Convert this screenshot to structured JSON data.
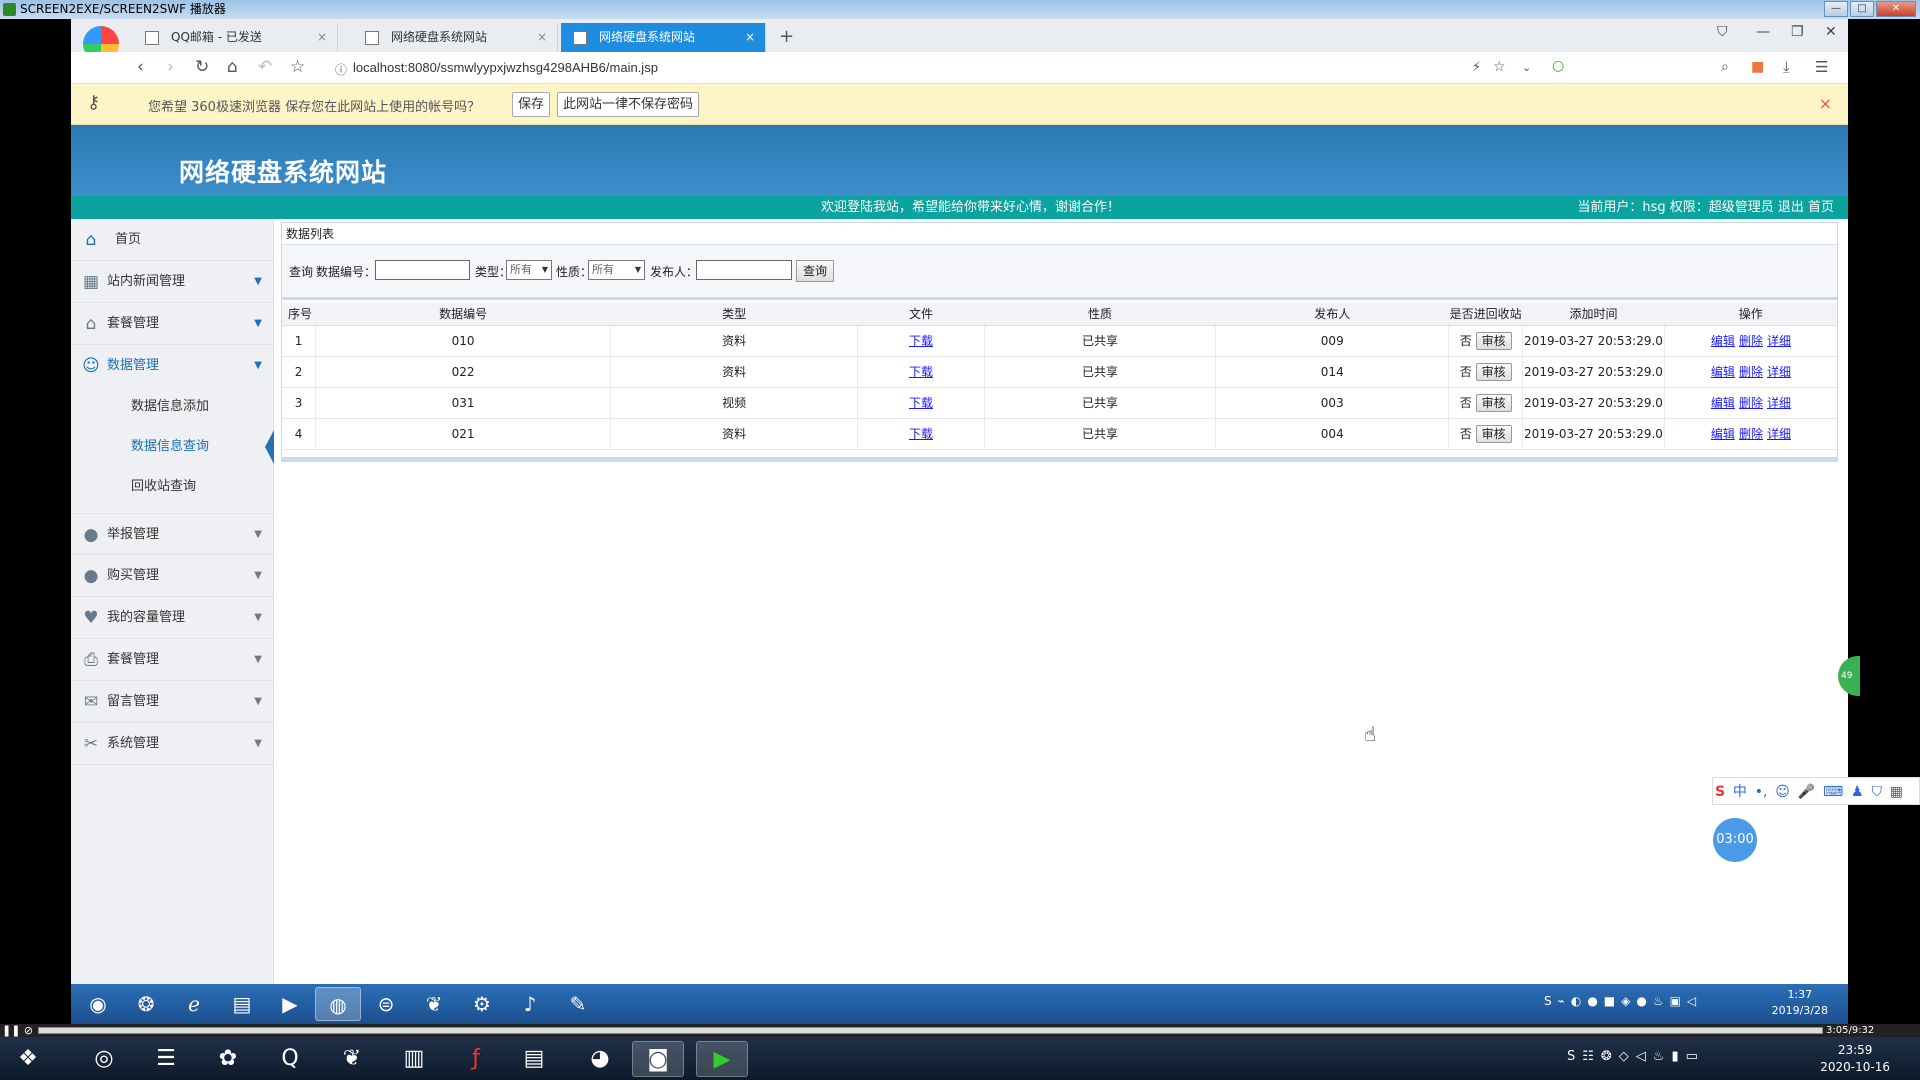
{
  "player": {
    "title": "SCREEN2EXE/SCREEN2SWF 播放器",
    "time": "3:05/9:32",
    "controls": "❚❚ ⊘"
  },
  "browser": {
    "tabs": [
      {
        "label": "QQ邮箱 - 已发送",
        "close": "×"
      },
      {
        "label": "网络硬盘系统网站",
        "close": "×"
      },
      {
        "label": "网络硬盘系统网站",
        "close": "×"
      }
    ],
    "new_tab": "+",
    "url": "localhost:8080/ssmwlyypxjwzhsg4298AHB6/main.jsp",
    "password_bar": {
      "message": "您希望 360极速浏览器 保存您在此网站上使用的帐号吗？",
      "save": "保存",
      "never": "此网站一律不保存密码",
      "close": "×"
    }
  },
  "site": {
    "title": "网络硬盘系统网站",
    "welcome": "欢迎登陆我站，希望能给你带来好心情，谢谢合作！",
    "user_info": "当前用户：hsg 权限：超级管理员 退出 首页"
  },
  "sidebar": {
    "home": "首页",
    "items": [
      {
        "label": "站内新闻管理",
        "icon": "grid-icon"
      },
      {
        "label": "套餐管理",
        "icon": "home-icon"
      },
      {
        "label": "数据管理",
        "icon": "users-icon"
      }
    ],
    "subitems": [
      "数据信息添加",
      "数据信息查询",
      "回收站查询"
    ],
    "items2": [
      {
        "label": "举报管理",
        "icon": "user-icon"
      },
      {
        "label": "购买管理",
        "icon": "user-icon"
      },
      {
        "label": "我的容量管理",
        "icon": "heart-icon"
      },
      {
        "label": "套餐管理",
        "icon": "printer-icon"
      },
      {
        "label": "留言管理",
        "icon": "message-icon"
      },
      {
        "label": "系统管理",
        "icon": "tools-icon"
      }
    ]
  },
  "panel": {
    "title": "数据列表",
    "query": {
      "prefix": "查询",
      "code_label": "数据编号：",
      "type_label": "类型：",
      "type_value": "所有",
      "nature_label": "性质：",
      "nature_value": "所有",
      "publisher_label": "发布人：",
      "button": "查询"
    },
    "columns": [
      "序号",
      "数据编号",
      "类型",
      "文件",
      "性质",
      "发布人",
      "是否进回收站",
      "添加时间",
      "操作"
    ],
    "rows": [
      {
        "no": "1",
        "code": "010",
        "type": "资料",
        "file": "下载",
        "nature": "已共享",
        "publisher": "009",
        "recycled": "否",
        "audit": "审核",
        "time": "2019-03-27 20:53:29.0",
        "edit": "编辑",
        "del": "删除",
        "detail": "详细"
      },
      {
        "no": "2",
        "code": "022",
        "type": "资料",
        "file": "下载",
        "nature": "已共享",
        "publisher": "014",
        "recycled": "否",
        "audit": "审核",
        "time": "2019-03-27 20:53:29.0",
        "edit": "编辑",
        "del": "删除",
        "detail": "详细"
      },
      {
        "no": "3",
        "code": "031",
        "type": "视频",
        "file": "下载",
        "nature": "已共享",
        "publisher": "003",
        "recycled": "否",
        "audit": "审核",
        "time": "2019-03-27 20:53:29.0",
        "edit": "编辑",
        "del": "删除",
        "detail": "详细"
      },
      {
        "no": "4",
        "code": "021",
        "type": "资料",
        "file": "下载",
        "nature": "已共享",
        "publisher": "004",
        "recycled": "否",
        "audit": "审核",
        "time": "2019-03-27 20:53:29.0",
        "edit": "编辑",
        "del": "删除",
        "detail": "详细"
      }
    ]
  },
  "overlays": {
    "timer": "03:00",
    "ime": "中",
    "bubble": "49"
  },
  "inner_taskbar": {
    "time": "1:37",
    "date": "2019/3/28"
  },
  "outer_taskbar": {
    "time": "23:59",
    "date": "2020-10-16"
  },
  "colors": {
    "banner": "#2a7ab6",
    "welcome_bar": "#0aa3a0",
    "active_tab": "#1e8de0",
    "link": "#1a1aff"
  }
}
